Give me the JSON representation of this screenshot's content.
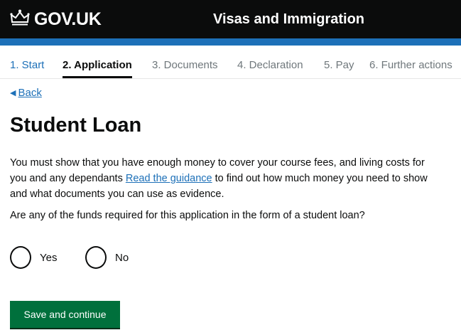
{
  "header": {
    "logo_text": "GOV.UK",
    "logo_icon": "crown-icon",
    "service_name": "Visas and Immigration",
    "colors": {
      "bar": "#0b0c0c",
      "accent_band": "#1d70b8"
    }
  },
  "steps": [
    {
      "label": "1. Start",
      "state": "link"
    },
    {
      "label": "2. Application",
      "state": "current"
    },
    {
      "label": "3. Documents",
      "state": "upcoming"
    },
    {
      "label": "4. Declaration",
      "state": "upcoming"
    },
    {
      "label": "5. Pay",
      "state": "upcoming"
    },
    {
      "label": "6. Further actions",
      "state": "upcoming"
    }
  ],
  "back": {
    "label": "Back",
    "icon": "triangle-left-icon"
  },
  "page": {
    "title": "Student Loan",
    "intro_before_link": "You must show that you have enough money to cover your course fees, and living costs for you and any dependants ",
    "intro_link": "Read the guidance",
    "intro_after_link": " to find out how much money you need to show and what documents you can use as evidence.",
    "question": "Are any of the funds required for this application in the form of a student loan?"
  },
  "options": [
    {
      "label": "Yes",
      "selected": false
    },
    {
      "label": "No",
      "selected": false
    }
  ],
  "submit": {
    "label": "Save and continue",
    "color": "#00703c"
  }
}
